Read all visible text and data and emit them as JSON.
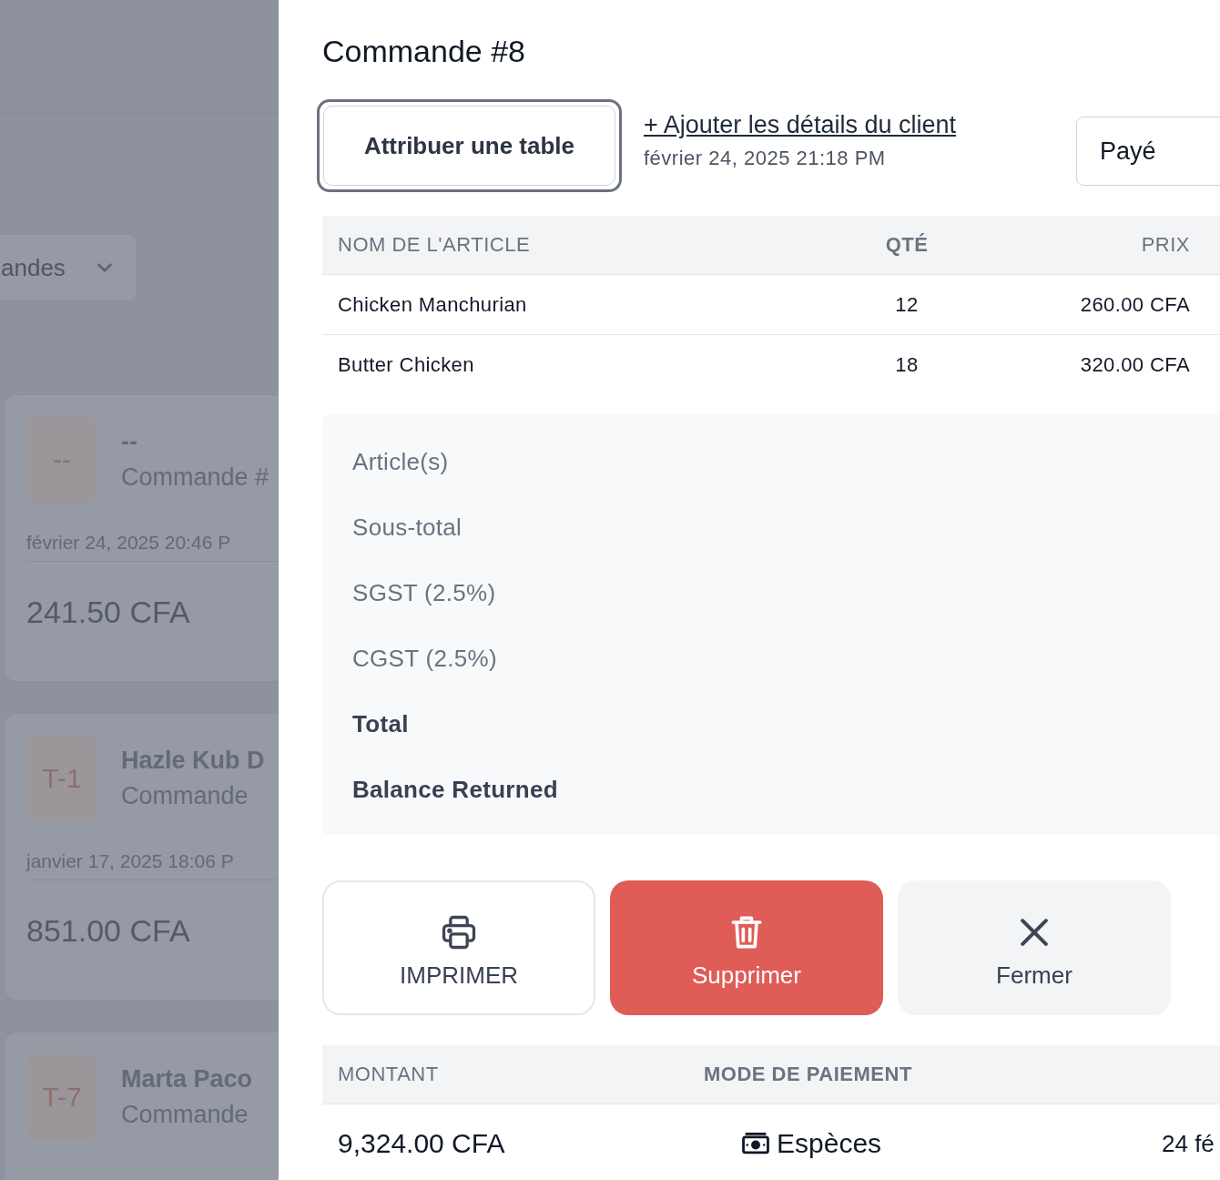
{
  "background": {
    "filter_dropdown": {
      "label": "andes"
    },
    "orders": [
      {
        "badge": "--",
        "name": "--",
        "subtitle": "Commande #",
        "date": "février 24, 2025 20:46 P",
        "amount": "241.50 CFA"
      },
      {
        "badge": "T-1",
        "name": "Hazle Kub D",
        "subtitle": "Commande",
        "date": "janvier 17, 2025 18:06 P",
        "amount": "851.00 CFA"
      },
      {
        "badge": "T-7",
        "name": "Marta Paco",
        "subtitle": "Commande"
      }
    ]
  },
  "panel": {
    "title": "Commande #8",
    "assign_table_button": "Attribuer une table",
    "add_customer_link": "+ Ajouter les détails du client",
    "date": "février 24, 2025 21:18 PM",
    "status_button": "Payé",
    "items_table": {
      "columns": [
        "NOM DE L'ARTICLE",
        "QTÉ",
        "PRIX"
      ],
      "rows": [
        {
          "name": "Chicken Manchurian",
          "qty": "12",
          "price": "260.00 CFA"
        },
        {
          "name": "Butter Chicken",
          "qty": "18",
          "price": "320.00 CFA"
        }
      ]
    },
    "summary": [
      {
        "label": "Article(s)",
        "kind": "normal"
      },
      {
        "label": "Sous-total",
        "kind": "normal"
      },
      {
        "label": "SGST (2.5%)",
        "kind": "normal"
      },
      {
        "label": "CGST (2.5%)",
        "kind": "normal"
      },
      {
        "label": "Total",
        "kind": "strong"
      },
      {
        "label": "Balance Returned",
        "kind": "strong"
      }
    ],
    "actions": [
      {
        "label": "IMPRIMER",
        "kind": "print"
      },
      {
        "label": "Supprimer",
        "kind": "delete"
      },
      {
        "label": "Fermer",
        "kind": "close"
      }
    ],
    "payments_table": {
      "columns": [
        "MONTANT",
        "MODE DE PAIEMENT"
      ],
      "rows": [
        {
          "amount": "9,324.00 CFA",
          "method": "Espèces",
          "date": "24 fé"
        }
      ]
    }
  }
}
